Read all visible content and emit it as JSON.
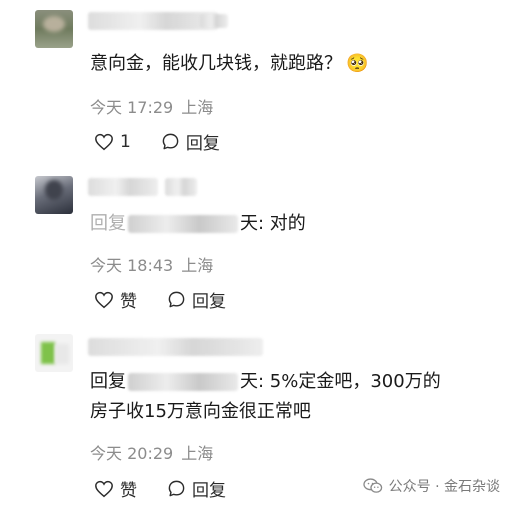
{
  "comments": [
    {
      "text": "意向金，能收几块钱，就跑路？",
      "emoji": "🥺",
      "date": "今天 17:29",
      "location": "上海",
      "like_label": "1",
      "reply_label": "回复"
    },
    {
      "text_prefix": "回复",
      "text_suffix": "天: 对的",
      "date": "今天 18:43",
      "location": "上海",
      "like_label": "赞",
      "reply_label": "回复"
    },
    {
      "text_prefix": "回复",
      "text_suffix": "天: 5%定金吧，300万的",
      "text_line2": "房子收15万意向金很正常吧",
      "date": "今天 20:29",
      "location": "上海",
      "like_label": "赞",
      "reply_label": "回复"
    }
  ],
  "watermark": "公众号 · 金石杂谈",
  "colors": {
    "meta": "#8c8c8c",
    "text": "#1a1a1a",
    "action": "#2b2b2b"
  }
}
